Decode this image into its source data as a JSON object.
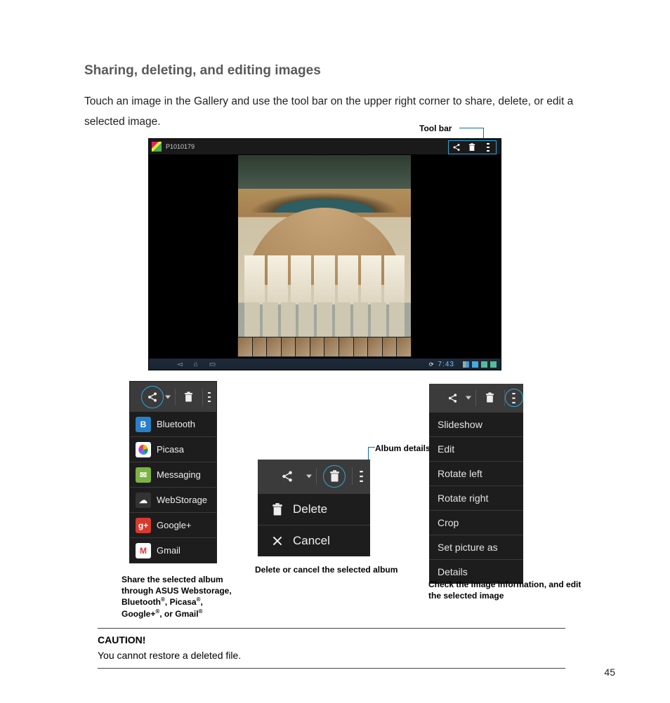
{
  "heading": "Sharing, deleting, and editing images",
  "body_text": "Touch an image in the Gallery and use the tool bar on the upper right corner to share, delete, or edit a selected image.",
  "toolbar_label": "Tool bar",
  "screenshot": {
    "photo_id": "P1010179",
    "clock": "7:43"
  },
  "share_menu": {
    "items": [
      {
        "name": "bluetooth",
        "label": "Bluetooth",
        "bg": "#2b7fc9",
        "glyph": "B"
      },
      {
        "name": "picasa",
        "label": "Picasa",
        "bg": "#ffffff",
        "glyph": ""
      },
      {
        "name": "messaging",
        "label": "Messaging",
        "bg": "#7cb342",
        "glyph": "✉"
      },
      {
        "name": "webstorage",
        "label": "WebStorage",
        "bg": "#333333",
        "glyph": "☁"
      },
      {
        "name": "googleplus",
        "label": "Google+",
        "bg": "#d63a2e",
        "glyph": "g+"
      },
      {
        "name": "gmail",
        "label": "Gmail",
        "bg": "#ffffff",
        "glyph": "M"
      }
    ],
    "caption_line1": "Share the selected album through ASUS Webstorage, Bluetooth",
    "caption_line2": ", Picasa",
    "caption_line3": ", Google+",
    "caption_line4": ", or Gmail",
    "reg": "®"
  },
  "delete_menu": {
    "delete_label": "Delete",
    "cancel_label": "Cancel",
    "caption": "Delete or cancel the selected album"
  },
  "album_details_label": "Album details",
  "options_menu": {
    "items": [
      "Slideshow",
      "Edit",
      "Rotate left",
      "Rotate right",
      "Crop",
      "Set picture as",
      "Details"
    ],
    "caption": "Check the image information, and edit the selected image"
  },
  "caution": {
    "heading": "CAUTION!",
    "text": "You cannot restore a deleted file."
  },
  "page_number": "45"
}
